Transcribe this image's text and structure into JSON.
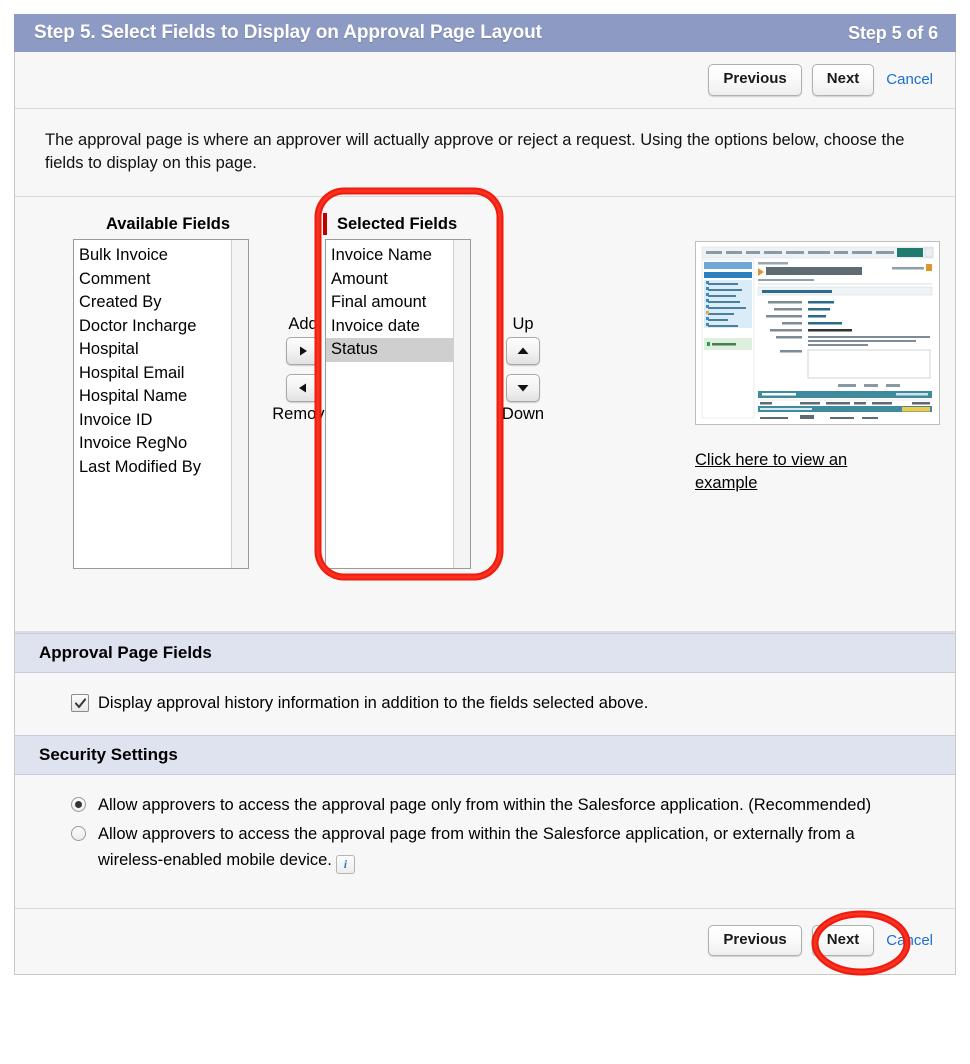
{
  "header": {
    "title": "Step 5. Select Fields to Display on Approval Page Layout",
    "step_count": "Step 5 of 6"
  },
  "toolbar_top": {
    "previous_label": "Previous",
    "next_label": "Next",
    "cancel_label": "Cancel"
  },
  "toolbar_bottom": {
    "previous_label": "Previous",
    "next_label": "Next",
    "cancel_label": "Cancel"
  },
  "description": "The approval page is where an approver will actually approve or reject a request. Using the options below, choose the fields to display on this page.",
  "picker": {
    "available_label": "Available Fields",
    "selected_label": "Selected Fields",
    "available_fields": [
      "Bulk Invoice",
      "Comment",
      "Created By",
      "Doctor Incharge",
      "Hospital",
      "Hospital Email",
      "Hospital Name",
      "Invoice ID",
      "Invoice RegNo",
      "Last Modified By"
    ],
    "selected_fields": [
      "Invoice Name",
      "Amount",
      "Final amount",
      "Invoice date",
      "Status"
    ],
    "selected_highlighted": "Status",
    "add_label": "Add",
    "remove_label": "Remove",
    "up_label": "Up",
    "down_label": "Down",
    "example_link": "Click here to view an example"
  },
  "approval_page_fields": {
    "section_title": "Approval Page Fields",
    "checkbox_label": "Display approval history information in addition to the fields selected above.",
    "checkbox_checked": true
  },
  "security_settings": {
    "section_title": "Security Settings",
    "option_1": "Allow approvers to access the approval page only from within the Salesforce application. (Recommended)",
    "option_2": "Allow approvers to access the approval page from within the Salesforce application, or externally from a wireless-enabled mobile device.",
    "selected_option": "option_1",
    "info_icon_glyph": "i"
  },
  "colors": {
    "title_bar": "#8d9bc4",
    "section_header": "#dfe3ef",
    "annotation": "#f01b0c",
    "link": "#1a6fd4",
    "required_marker": "#c00000",
    "selection_highlight": "#cfcfcf"
  }
}
